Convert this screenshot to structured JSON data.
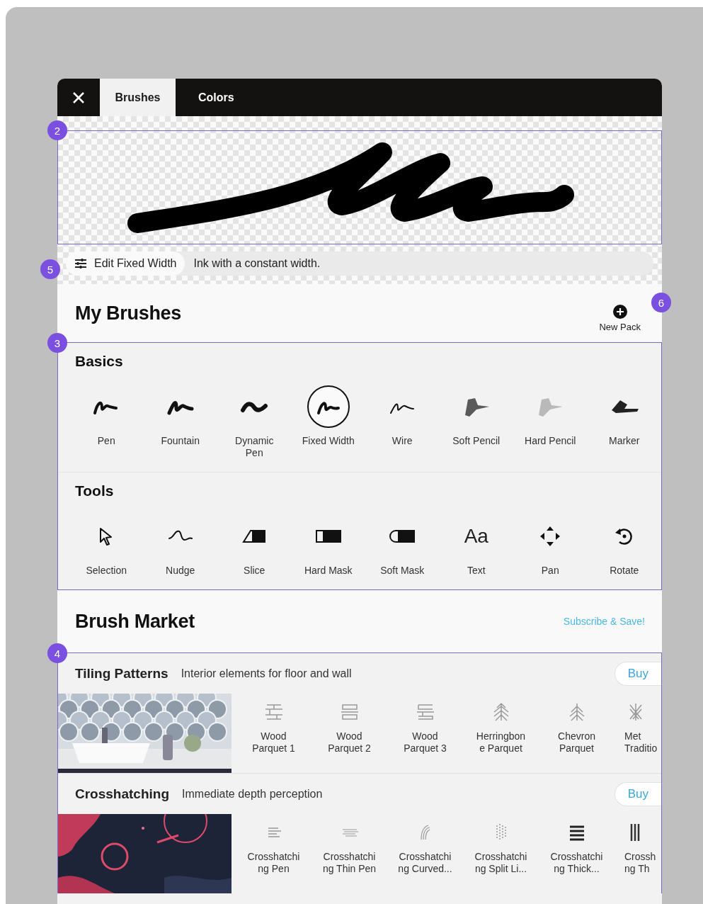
{
  "tabs": [
    {
      "label": "Brushes",
      "selected": true
    },
    {
      "label": "Colors",
      "selected": false
    }
  ],
  "preview": {
    "badge": "2"
  },
  "edit_bar": {
    "badge": "5",
    "button": "Edit Fixed Width",
    "description": "Ink with a constant width."
  },
  "my_brushes": {
    "title": "My Brushes",
    "badge": "3",
    "new_pack": {
      "label": "New Pack",
      "badge": "6"
    },
    "groups": [
      {
        "title": "Basics",
        "items": [
          {
            "kind": "pen",
            "lines": [
              "Pen"
            ],
            "selected": false
          },
          {
            "kind": "fountain",
            "lines": [
              "Fountain"
            ],
            "selected": false
          },
          {
            "kind": "dynamic",
            "lines": [
              "Dynamic",
              "Pen"
            ],
            "selected": false
          },
          {
            "kind": "fixed",
            "lines": [
              "Fixed Width"
            ],
            "selected": true
          },
          {
            "kind": "wire",
            "lines": [
              "Wire"
            ],
            "selected": false
          },
          {
            "kind": "soft-pencil",
            "lines": [
              "Soft Pencil"
            ],
            "selected": false
          },
          {
            "kind": "hard-pencil",
            "lines": [
              "Hard Pencil"
            ],
            "selected": false
          },
          {
            "kind": "marker",
            "lines": [
              "Marker"
            ],
            "selected": false
          }
        ]
      },
      {
        "title": "Tools",
        "items": [
          {
            "kind": "selection",
            "lines": [
              "Selection"
            ],
            "selected": false
          },
          {
            "kind": "nudge",
            "lines": [
              "Nudge"
            ],
            "selected": false
          },
          {
            "kind": "slice",
            "lines": [
              "Slice"
            ],
            "selected": false
          },
          {
            "kind": "hard-mask",
            "lines": [
              "Hard Mask"
            ],
            "selected": false
          },
          {
            "kind": "soft-mask",
            "lines": [
              "Soft Mask"
            ],
            "selected": false
          },
          {
            "kind": "text",
            "glyph": "Aa",
            "lines": [
              "Text"
            ],
            "selected": false
          },
          {
            "kind": "pan",
            "lines": [
              "Pan"
            ],
            "selected": false
          },
          {
            "kind": "rotate",
            "lines": [
              "Rotate"
            ],
            "selected": false
          }
        ]
      }
    ]
  },
  "brush_market": {
    "title": "Brush Market",
    "link": "Subscribe & Save!",
    "badge": "4",
    "packs": [
      {
        "title": "Tiling Patterns",
        "subtitle": "Interior elements for floor and wall",
        "button": "Buy",
        "items": [
          {
            "kind": "parquet-1",
            "lines": [
              "Wood",
              "Parquet 1"
            ]
          },
          {
            "kind": "parquet-2",
            "lines": [
              "Wood",
              "Parquet 2"
            ]
          },
          {
            "kind": "parquet-3",
            "lines": [
              "Wood",
              "Parquet 3"
            ]
          },
          {
            "kind": "herringbone",
            "lines": [
              "Herringbon",
              "e Parquet"
            ]
          },
          {
            "kind": "chevron",
            "lines": [
              "Chevron",
              "Parquet"
            ]
          },
          {
            "kind": "lattice",
            "lines": [
              "Met",
              "Traditio"
            ]
          }
        ]
      },
      {
        "title": "Crosshatching",
        "subtitle": "Immediate depth perception",
        "button": "Buy",
        "items": [
          {
            "kind": "hatch-pen",
            "lines": [
              "Crosshatchi",
              "ng Pen"
            ]
          },
          {
            "kind": "hatch-thin",
            "lines": [
              "Crosshatchi",
              "ng Thin Pen"
            ]
          },
          {
            "kind": "hatch-curved",
            "lines": [
              "Crosshatchi",
              "ng Curved..."
            ]
          },
          {
            "kind": "hatch-split",
            "lines": [
              "Crosshatchi",
              "ng Split Li..."
            ]
          },
          {
            "kind": "hatch-thick",
            "lines": [
              "Crosshatchi",
              "ng Thick..."
            ]
          },
          {
            "kind": "hatch-bars",
            "lines": [
              "Crossh",
              "ng Th"
            ]
          }
        ]
      }
    ]
  }
}
